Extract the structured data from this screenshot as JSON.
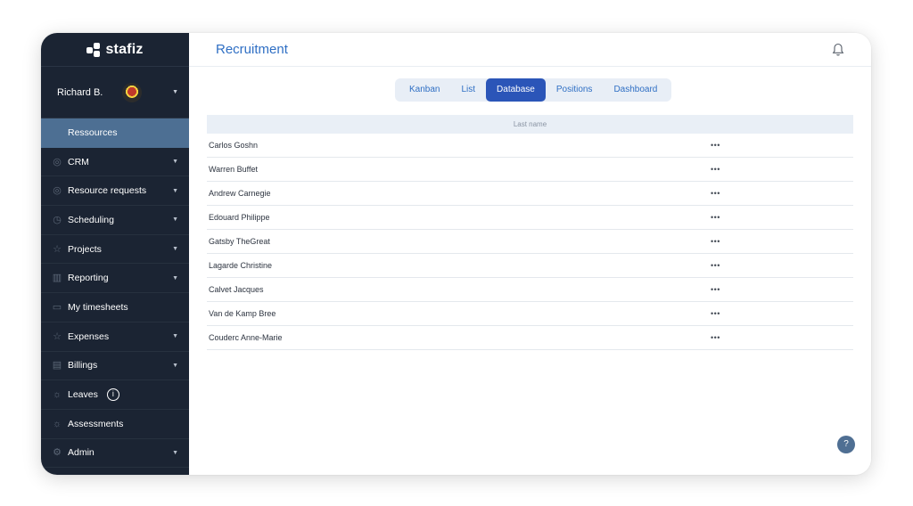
{
  "brand": {
    "name": "stafiz"
  },
  "user": {
    "name": "Richard B."
  },
  "sidebar": {
    "items": [
      {
        "label": "Ressources",
        "icon": "people-icon",
        "active": true,
        "has_caret": false
      },
      {
        "label": "CRM",
        "icon": "user-circle-icon",
        "has_caret": true
      },
      {
        "label": "Resource requests",
        "icon": "user-circle-icon",
        "has_caret": true
      },
      {
        "label": "Scheduling",
        "icon": "clock-icon",
        "has_caret": true
      },
      {
        "label": "Projects",
        "icon": "star-icon",
        "has_caret": true
      },
      {
        "label": "Reporting",
        "icon": "bar-chart-icon",
        "has_caret": true
      },
      {
        "label": "My timesheets",
        "icon": "calendar-icon",
        "has_caret": false
      },
      {
        "label": "Expenses",
        "icon": "star-icon",
        "has_caret": true
      },
      {
        "label": "Billings",
        "icon": "document-icon",
        "has_caret": true
      },
      {
        "label": "Leaves",
        "icon": "sun-icon",
        "has_caret": false,
        "info": "i"
      },
      {
        "label": "Assessments",
        "icon": "sun-icon",
        "has_caret": false
      },
      {
        "label": "Admin",
        "icon": "gear-icon",
        "has_caret": true
      }
    ]
  },
  "header": {
    "title": "Recruitment"
  },
  "tabs": [
    {
      "label": "Kanban"
    },
    {
      "label": "List"
    },
    {
      "label": "Database",
      "active": true
    },
    {
      "label": "Positions"
    },
    {
      "label": "Dashboard"
    }
  ],
  "table": {
    "column_header": "Last name",
    "rows": [
      {
        "name": "Carlos Goshn",
        "actions": "•••"
      },
      {
        "name": "Warren Buffet",
        "actions": "•••"
      },
      {
        "name": "Andrew Carnegie",
        "actions": "•••"
      },
      {
        "name": "Edouard Philippe",
        "actions": "•••"
      },
      {
        "name": "Gatsby TheGreat",
        "actions": "•••"
      },
      {
        "name": "Lagarde Christine",
        "actions": "•••"
      },
      {
        "name": "Calvet Jacques",
        "actions": "•••"
      },
      {
        "name": "Van de Kamp Bree",
        "actions": "•••"
      },
      {
        "name": "Couderc Anne-Marie",
        "actions": "•••"
      }
    ]
  },
  "help": {
    "label": "?"
  },
  "colors": {
    "sidebar_bg": "#1b2433",
    "active_item": "#4d6f93",
    "accent": "#2f6fc4",
    "active_tab": "#2b55b8"
  }
}
